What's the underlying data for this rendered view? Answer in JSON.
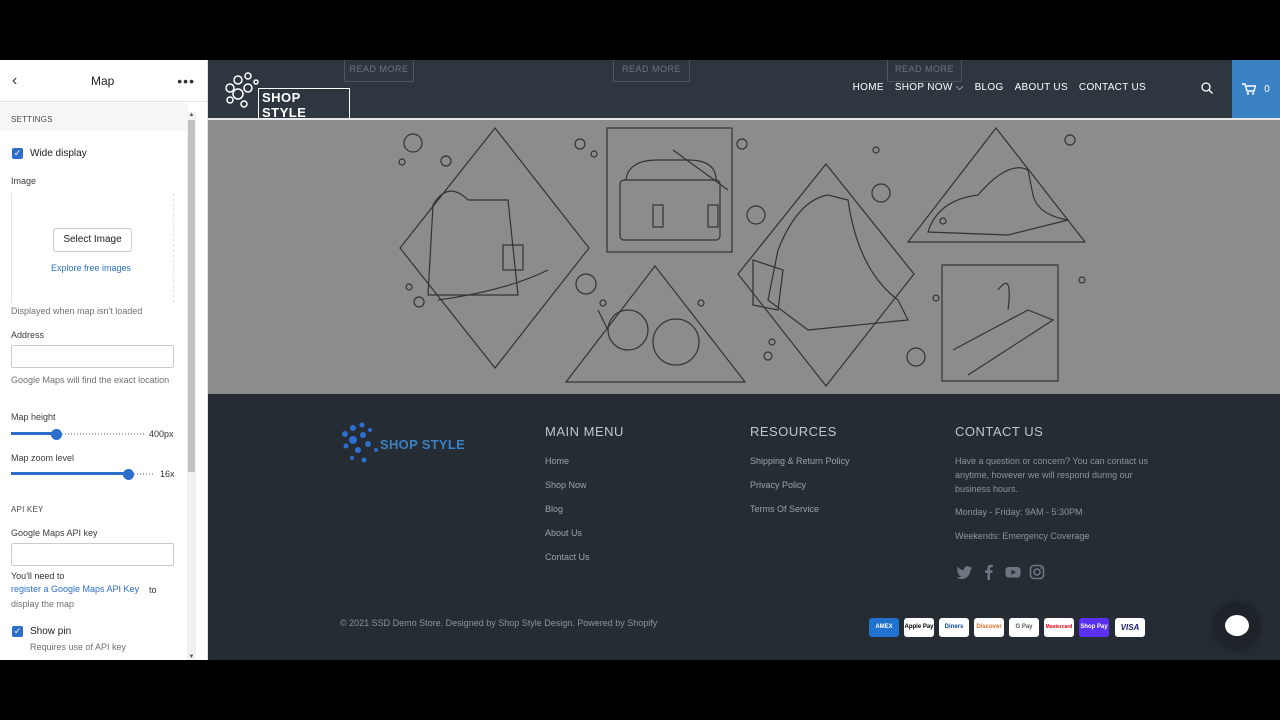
{
  "panel": {
    "title": "Map",
    "back_icon": "‹",
    "more_icon": "•••",
    "settings_header": "SETTINGS",
    "wide_display_label": "Wide display",
    "wide_display_checked": true,
    "image_label": "Image",
    "select_image_label": "Select Image",
    "explore_link": "Explore free images",
    "image_help": "Displayed when map isn't loaded",
    "address_label": "Address",
    "address_value": "",
    "address_help": "Google Maps will find the exact location",
    "map_height_label": "Map height",
    "map_height_value": "400px",
    "map_height_fraction": 0.34,
    "zoom_label": "Map zoom level",
    "zoom_value": "16x",
    "zoom_fraction": 0.82,
    "api_header": "API KEY",
    "api_label": "Google Maps API key",
    "api_value": "",
    "api_help_prefix": "You'll need to",
    "api_help_link": "register a Google Maps API Key",
    "api_help_to": "to",
    "api_help_suffix": "display the map",
    "show_pin_label": "Show pin",
    "show_pin_checked": true,
    "show_pin_help": "Requires use of API key"
  },
  "header": {
    "read_more": [
      "READ MORE",
      "READ MORE",
      "READ MORE"
    ],
    "logo_text": "SHOP STYLE",
    "nav": [
      "HOME",
      "SHOP NOW",
      "BLOG",
      "ABOUT US",
      "CONTACT US"
    ],
    "shop_now_caret": "⌵",
    "cart_icon": "cart-icon",
    "cart_count": "0"
  },
  "footer": {
    "logo_text": "SHOP STYLE",
    "main_menu_title": "MAIN MENU",
    "main_menu": [
      "Home",
      "Shop Now",
      "Blog",
      "About Us",
      "Contact Us"
    ],
    "resources_title": "RESOURCES",
    "resources": [
      "Shipping & Return Policy",
      "Privacy Policy",
      "Terms Of Service"
    ],
    "contact_title": "CONTACT US",
    "contact_text": "Have a question or concern? You can contact us anytime, however we will respond during our business hours.",
    "hours": "Monday - Friday: 9AM - 5:30PM",
    "weekends": "Weekends: Emergency Coverage",
    "copyright": "© 2021 SSD Demo Store. Designed by Shop Style Design. Powered by Shopify",
    "payments": [
      "AMEX",
      "Apple Pay",
      "Diners",
      "Discover",
      "G Pay",
      "Mastercard",
      "Shop Pay",
      "VISA"
    ]
  },
  "colors": {
    "accent": "#2c6ecb",
    "cart_bg": "#3b82c4",
    "footer_bg": "#252c34",
    "map_bg": "#8c8c8c"
  }
}
